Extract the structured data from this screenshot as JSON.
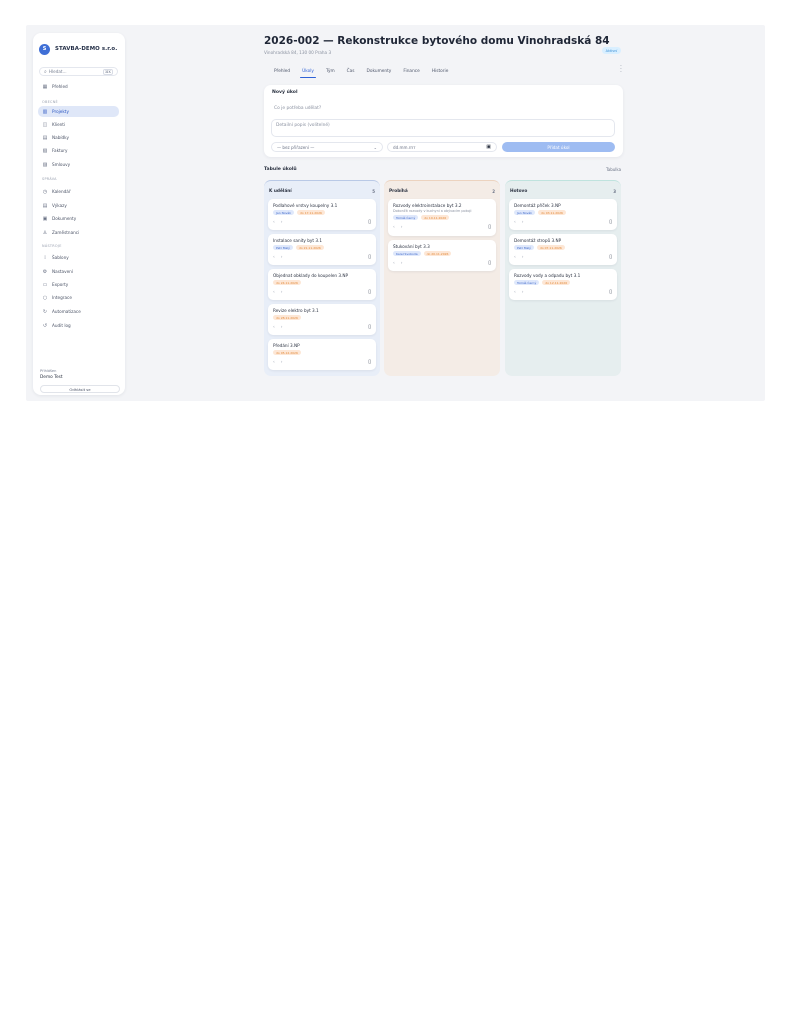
{
  "brand": {
    "logo": "S",
    "name": "STAVBA-DEMO s.r.o."
  },
  "search": {
    "placeholder": "Hledat...",
    "shortcut": "⌘K"
  },
  "sidebar": {
    "top_item": {
      "label": "Přehled",
      "icon": "grid-icon"
    },
    "sections": [
      {
        "label": "OBECNÉ",
        "items": [
          {
            "label": "Projekty",
            "icon": "building-icon",
            "active": true
          },
          {
            "label": "Klienti",
            "icon": "people-icon"
          },
          {
            "label": "Nabídky",
            "icon": "document-icon"
          },
          {
            "label": "Faktury",
            "icon": "invoice-icon"
          },
          {
            "label": "Smlouvy",
            "icon": "contract-icon"
          }
        ]
      },
      {
        "label": "SPRÁVA",
        "items": [
          {
            "label": "Kalendář",
            "icon": "clock-icon"
          },
          {
            "label": "Výkazy",
            "icon": "report-icon"
          },
          {
            "label": "Dokumenty",
            "icon": "calendar-icon"
          },
          {
            "label": "Zaměstnanci",
            "icon": "user-icon"
          }
        ]
      },
      {
        "label": "NÁSTROJE",
        "items": [
          {
            "label": "Šablony",
            "icon": "template-icon"
          },
          {
            "label": "Nastavení",
            "icon": "gear-icon"
          },
          {
            "label": "Exporty",
            "icon": "export-icon"
          },
          {
            "label": "Integrace",
            "icon": "plug-icon"
          },
          {
            "label": "Automatizace",
            "icon": "automation-icon"
          },
          {
            "label": "Audit log",
            "icon": "history-icon"
          }
        ]
      }
    ],
    "user_label": "Přihlášen",
    "user_name": "Demo Test",
    "logout_label": "Odhlásit se"
  },
  "project": {
    "title": "2026-002 — Rekonstrukce bytového domu Vinohradská 84",
    "subtitle": "Vinohradská 84, 130 00 Praha 3",
    "status": "Aktivní"
  },
  "tabs": [
    "Přehled",
    "Úkoly",
    "Tým",
    "Čas",
    "Dokumenty",
    "Finance",
    "Historie"
  ],
  "active_tab": 1,
  "new_task": {
    "heading": "Nový úkol",
    "title_placeholder": "Co je potřeba udělat?",
    "desc_placeholder": "Detailní popis (volitelné)",
    "assignee": "— bez přiřazení —",
    "date": "dd.mm.rrrr",
    "submit": "Přidat úkol"
  },
  "board": {
    "title": "Tabule úkolů",
    "view_label": "Tabulka",
    "columns": [
      {
        "name": "K udělání",
        "count": "5",
        "bg": "#e8eef8",
        "border": "#b9c9e6",
        "cards": [
          {
            "title": "Podlahové vrstvy koupelny 3.1",
            "badges": [
              {
                "t": "Jan Novák",
                "c": "blue"
              },
              {
                "t": "do 17.11.2026",
                "c": "orange"
              }
            ]
          },
          {
            "title": "Instalace sanity byt 3.1",
            "badges": [
              {
                "t": "Petr Malý",
                "c": "blue"
              },
              {
                "t": "do 21.11.2026",
                "c": "orange"
              }
            ]
          },
          {
            "title": "Objednat obklady do koupelen 3.NP",
            "badges": [
              {
                "t": "do 24.11.2026",
                "c": "orange"
              }
            ]
          },
          {
            "title": "Revize elektro byt 3.1",
            "badges": [
              {
                "t": "do 28.11.2026",
                "c": "orange"
              }
            ]
          },
          {
            "title": "Předání 3.NP",
            "badges": [
              {
                "t": "do 05.12.2026",
                "c": "orange"
              }
            ]
          }
        ]
      },
      {
        "name": "Probíhá",
        "count": "2",
        "bg": "#f4ece6",
        "border": "#ecd3bf",
        "cards": [
          {
            "title": "Rozvody elektroinstalace byt 3.2",
            "desc": "Dokončit rozvody v kuchyni a obývacím pokoji",
            "badges": [
              {
                "t": "Tomáš Černý",
                "c": "blue"
              },
              {
                "t": "do 19.11.2026",
                "c": "orange"
              }
            ]
          },
          {
            "title": "Štukování byt 3.3",
            "badges": [
              {
                "t": "Karel Svoboda",
                "c": "blue"
              },
              {
                "t": "do 20.11.2026",
                "c": "orange"
              }
            ]
          }
        ]
      },
      {
        "name": "Hotovo",
        "count": "3",
        "bg": "#e6eeef",
        "border": "#bfe3de",
        "cards": [
          {
            "title": "Demontáž příček 3.NP",
            "badges": [
              {
                "t": "Jan Novák",
                "c": "blue"
              },
              {
                "t": "do 03.11.2026",
                "c": "orange"
              }
            ]
          },
          {
            "title": "Demontáž stropů 3.NP",
            "badges": [
              {
                "t": "Petr Malý",
                "c": "blue"
              },
              {
                "t": "do 07.11.2026",
                "c": "orange"
              }
            ]
          },
          {
            "title": "Rozvody vody a odpadu byt 3.1",
            "badges": [
              {
                "t": "Tomáš Černý",
                "c": "blue"
              },
              {
                "t": "do 12.11.2026",
                "c": "orange"
              }
            ]
          }
        ]
      }
    ]
  }
}
